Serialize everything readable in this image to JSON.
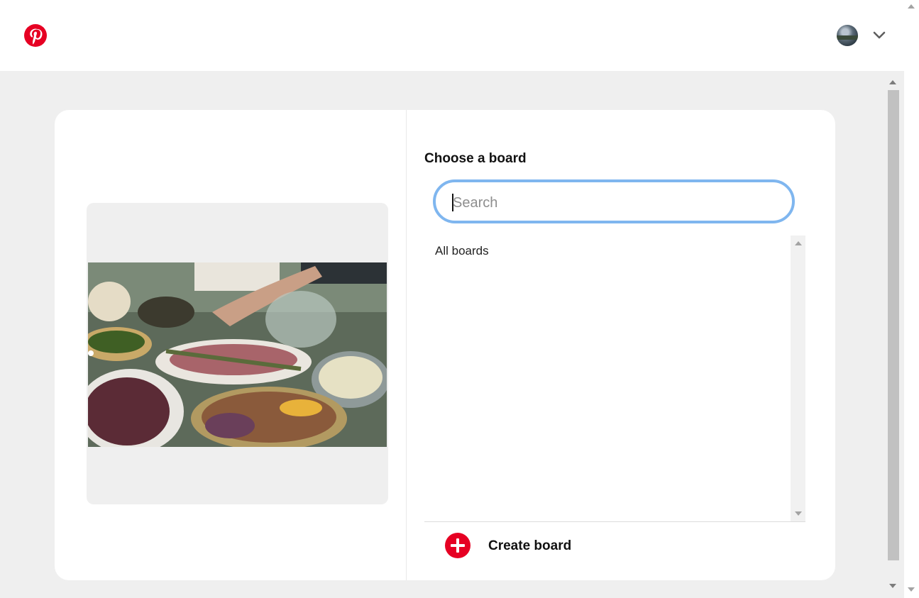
{
  "header": {
    "logo_icon": "pinterest-logo-icon",
    "avatar_icon": "user-avatar",
    "menu_icon": "chevron-down-icon"
  },
  "colors": {
    "brand": "#e60023",
    "focus_ring": "#7fb6ef",
    "page_bg": "#efefef"
  },
  "pin": {
    "image_icon": "food-photo"
  },
  "board_picker": {
    "title": "Choose a board",
    "search_placeholder": "Search",
    "search_value": "",
    "section_label": "All boards",
    "create_label": "Create board",
    "create_icon": "plus-circle-icon"
  }
}
